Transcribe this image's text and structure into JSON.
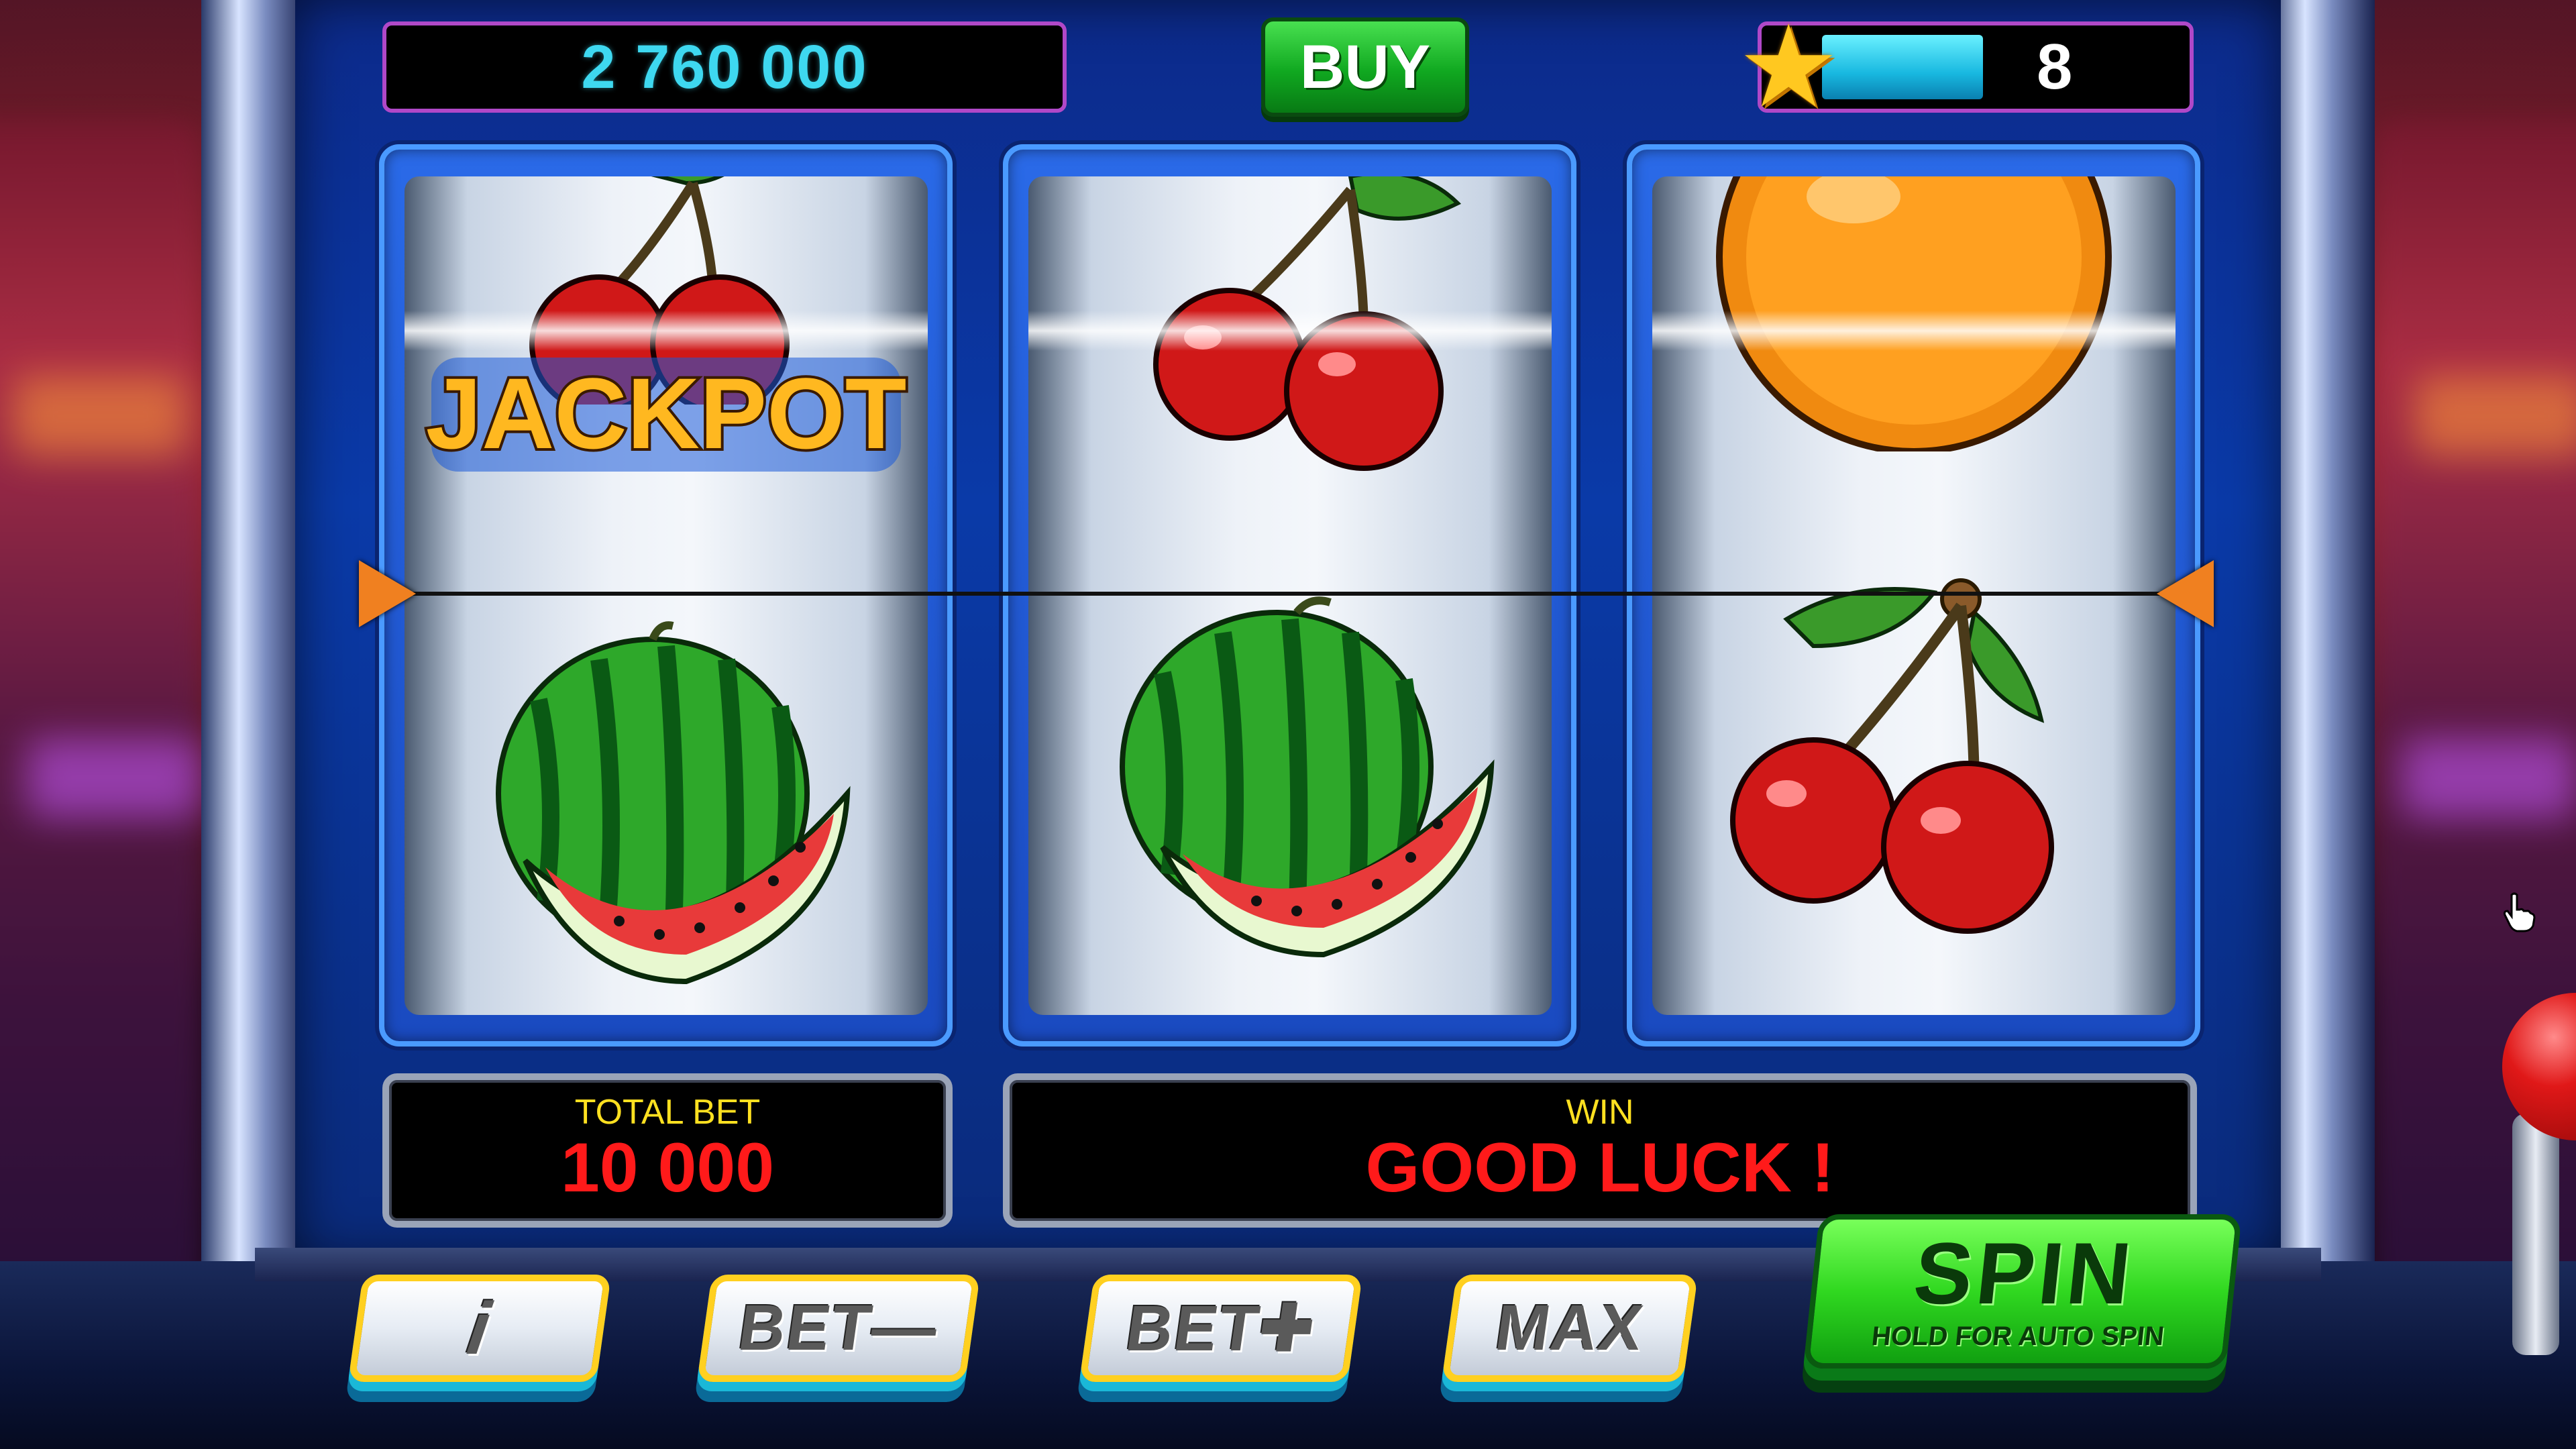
{
  "top_bar": {
    "balance": "2 760 000",
    "buy_label": "BUY",
    "level": "8",
    "level_progress": 0.4
  },
  "reels": [
    {
      "symbols": [
        "cherry",
        "jackpot",
        "watermelon"
      ]
    },
    {
      "symbols": [
        "cherry",
        "watermelon"
      ]
    },
    {
      "symbols": [
        "orange",
        "cherry"
      ]
    }
  ],
  "jackpot_text": "JACKPOT",
  "panels": {
    "total_bet_label": "TOTAL BET",
    "total_bet_value": "10 000",
    "win_label": "WIN",
    "win_value": "GOOD LUCK !"
  },
  "controls": {
    "info_label": "i",
    "bet_minus_label": "BET—",
    "bet_plus_label": "BET✚",
    "max_label": "MAX",
    "spin_label": "SPIN",
    "spin_sub_label": "HOLD FOR AUTO SPIN"
  },
  "colors": {
    "balance_text": "#3ed8f0",
    "panel_label": "#ffe020",
    "panel_value": "#ff1a1a",
    "button_border": "#ffd020",
    "spin_green": "#30d820"
  }
}
